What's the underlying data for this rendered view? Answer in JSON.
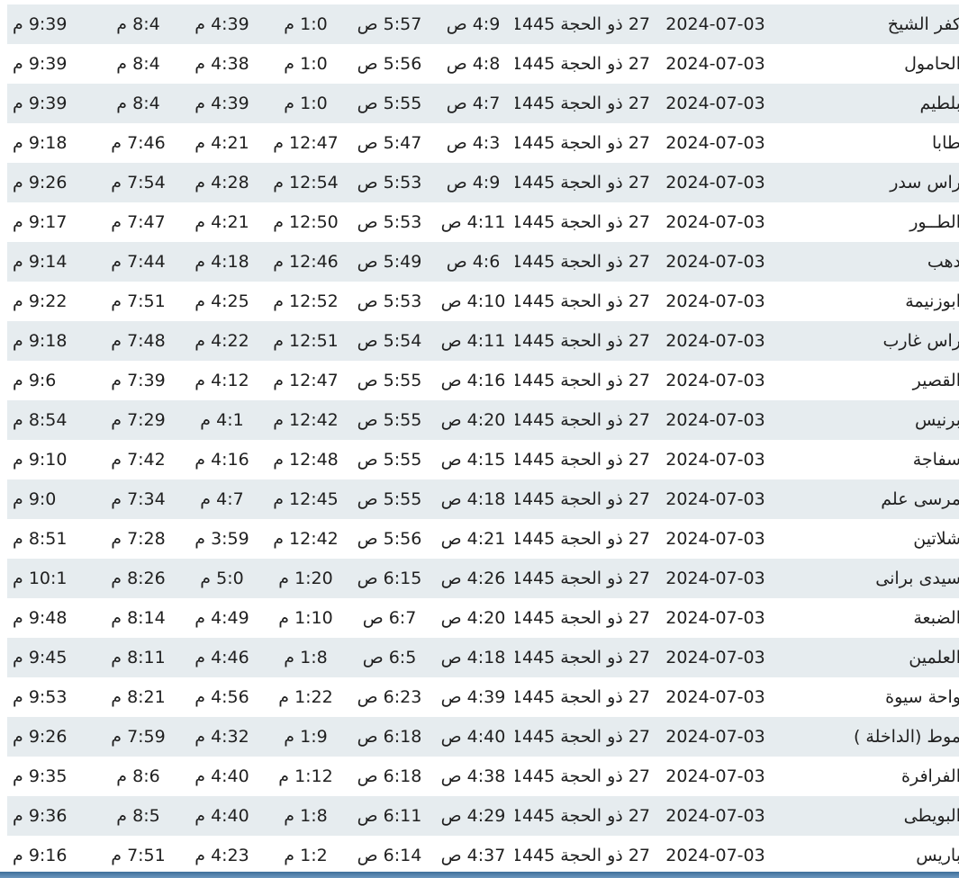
{
  "rows": [
    [
      "كفر الشيخ",
      "2024-07-03",
      "27 ذو الحجة 1445",
      "4:9 ص",
      "5:57 ص",
      "1:0 م",
      "4:39 م",
      "8:4 م",
      "9:39 م"
    ],
    [
      "الحامول",
      "2024-07-03",
      "27 ذو الحجة 1445",
      "4:8 ص",
      "5:56 ص",
      "1:0 م",
      "4:38 م",
      "8:4 م",
      "9:39 م"
    ],
    [
      "بلطيم",
      "2024-07-03",
      "27 ذو الحجة 1445",
      "4:7 ص",
      "5:55 ص",
      "1:0 م",
      "4:39 م",
      "8:4 م",
      "9:39 م"
    ],
    [
      "طابا",
      "2024-07-03",
      "27 ذو الحجة 1445",
      "4:3 ص",
      "5:47 ص",
      "12:47 م",
      "4:21 م",
      "7:46 م",
      "9:18 م"
    ],
    [
      "راس سدر",
      "2024-07-03",
      "27 ذو الحجة 1445",
      "4:9 ص",
      "5:53 ص",
      "12:54 م",
      "4:28 م",
      "7:54 م",
      "9:26 م"
    ],
    [
      "الطــور",
      "2024-07-03",
      "27 ذو الحجة 1445",
      "4:11 ص",
      "5:53 ص",
      "12:50 م",
      "4:21 م",
      "7:47 م",
      "9:17 م"
    ],
    [
      "دهب",
      "2024-07-03",
      "27 ذو الحجة 1445",
      "4:6 ص",
      "5:49 ص",
      "12:46 م",
      "4:18 م",
      "7:44 م",
      "9:14 م"
    ],
    [
      "ابوزنيمة",
      "2024-07-03",
      "27 ذو الحجة 1445",
      "4:10 ص",
      "5:53 ص",
      "12:52 م",
      "4:25 م",
      "7:51 م",
      "9:22 م"
    ],
    [
      "راس غارب",
      "2024-07-03",
      "27 ذو الحجة 1445",
      "4:11 ص",
      "5:54 ص",
      "12:51 م",
      "4:22 م",
      "7:48 م",
      "9:18 م"
    ],
    [
      "القصير",
      "2024-07-03",
      "27 ذو الحجة 1445",
      "4:16 ص",
      "5:55 ص",
      "12:47 م",
      "4:12 م",
      "7:39 م",
      "9:6 م"
    ],
    [
      "برنيس",
      "2024-07-03",
      "27 ذو الحجة 1445",
      "4:20 ص",
      "5:55 ص",
      "12:42 م",
      "4:1 م",
      "7:29 م",
      "8:54 م"
    ],
    [
      "سفاجة",
      "2024-07-03",
      "27 ذو الحجة 1445",
      "4:15 ص",
      "5:55 ص",
      "12:48 م",
      "4:16 م",
      "7:42 م",
      "9:10 م"
    ],
    [
      "مرسى علم",
      "2024-07-03",
      "27 ذو الحجة 1445",
      "4:18 ص",
      "5:55 ص",
      "12:45 م",
      "4:7 م",
      "7:34 م",
      "9:0 م"
    ],
    [
      "شلاتين",
      "2024-07-03",
      "27 ذو الحجة 1445",
      "4:21 ص",
      "5:56 ص",
      "12:42 م",
      "3:59 م",
      "7:28 م",
      "8:51 م"
    ],
    [
      "سيدى برانى",
      "2024-07-03",
      "27 ذو الحجة 1445",
      "4:26 ص",
      "6:15 ص",
      "1:20 م",
      "5:0 م",
      "8:26 م",
      "10:1 م"
    ],
    [
      "الضبعة",
      "2024-07-03",
      "27 ذو الحجة 1445",
      "4:20 ص",
      "6:7 ص",
      "1:10 م",
      "4:49 م",
      "8:14 م",
      "9:48 م"
    ],
    [
      "العلمين",
      "2024-07-03",
      "27 ذو الحجة 1445",
      "4:18 ص",
      "6:5 ص",
      "1:8 م",
      "4:46 م",
      "8:11 م",
      "9:45 م"
    ],
    [
      "واحة سيوة",
      "2024-07-03",
      "27 ذو الحجة 1445",
      "4:39 ص",
      "6:23 ص",
      "1:22 م",
      "4:56 م",
      "8:21 م",
      "9:53 م"
    ],
    [
      "موط (الداخلة )",
      "2024-07-03",
      "27 ذو الحجة 1445",
      "4:40 ص",
      "6:18 ص",
      "1:9 م",
      "4:32 م",
      "7:59 م",
      "9:26 م"
    ],
    [
      "الفرافرة",
      "2024-07-03",
      "27 ذو الحجة 1445",
      "4:38 ص",
      "6:18 ص",
      "1:12 م",
      "4:40 م",
      "8:6 م",
      "9:35 م"
    ],
    [
      "البويطى",
      "2024-07-03",
      "27 ذو الحجة 1445",
      "4:29 ص",
      "6:11 ص",
      "1:8 م",
      "4:40 م",
      "8:5 م",
      "9:36 م"
    ],
    [
      "باريس",
      "2024-07-03",
      "27 ذو الحجة 1445",
      "4:37 ص",
      "6:14 ص",
      "1:2 م",
      "4:23 م",
      "7:51 م",
      "9:16 م"
    ]
  ]
}
